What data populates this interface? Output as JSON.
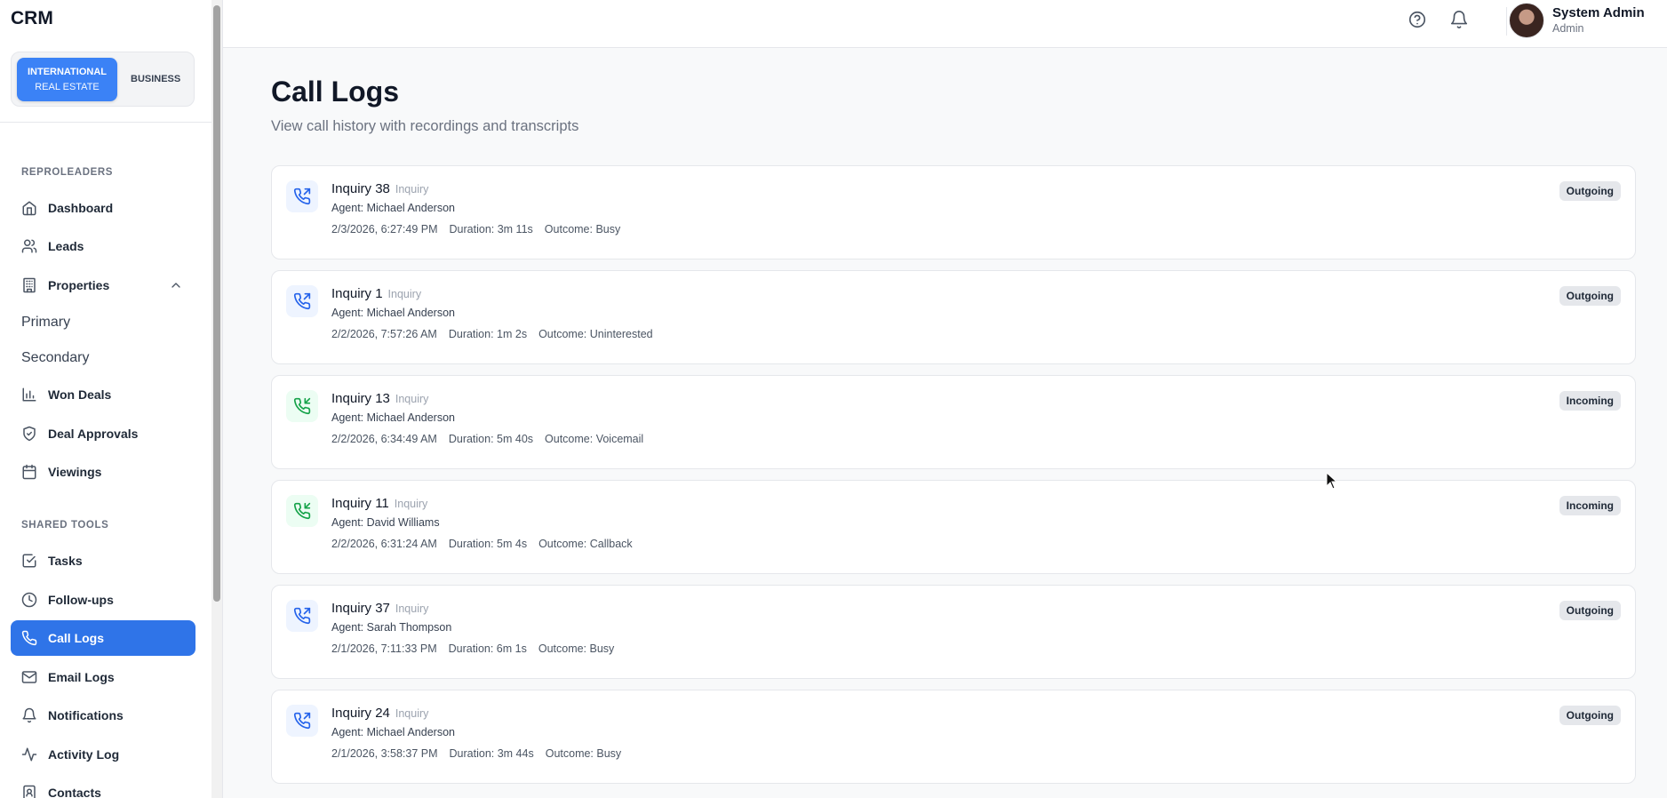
{
  "app": {
    "brand": "CRM"
  },
  "mode_toggle": {
    "active_line1": "INTERNATIONAL",
    "active_line2": "REAL ESTATE",
    "inactive": "BUSINESS"
  },
  "sidebar": {
    "section1": "REPROLEADERS",
    "dashboard": "Dashboard",
    "leads": "Leads",
    "properties": "Properties",
    "primary": "Primary",
    "secondary": "Secondary",
    "won_deals": "Won Deals",
    "deal_approvals": "Deal Approvals",
    "viewings": "Viewings",
    "section2": "SHARED TOOLS",
    "tasks": "Tasks",
    "followups": "Follow-ups",
    "call_logs": "Call Logs",
    "email_logs": "Email Logs",
    "notifications": "Notifications",
    "activity_log": "Activity Log",
    "contacts": "Contacts"
  },
  "header": {
    "user_name": "System Admin",
    "user_role": "Admin"
  },
  "page": {
    "title": "Call Logs",
    "subtitle": "View call history with recordings and transcripts"
  },
  "calls": [
    {
      "title": "Inquiry 38",
      "type": "Inquiry",
      "agent": "Agent: Michael Anderson",
      "datetime": "2/3/2026, 6:27:49 PM",
      "duration": "Duration: 3m 11s",
      "outcome": "Outcome: Busy",
      "direction": "Outgoing"
    },
    {
      "title": "Inquiry 1",
      "type": "Inquiry",
      "agent": "Agent: Michael Anderson",
      "datetime": "2/2/2026, 7:57:26 AM",
      "duration": "Duration: 1m 2s",
      "outcome": "Outcome: Uninterested",
      "direction": "Outgoing"
    },
    {
      "title": "Inquiry 13",
      "type": "Inquiry",
      "agent": "Agent: Michael Anderson",
      "datetime": "2/2/2026, 6:34:49 AM",
      "duration": "Duration: 5m 40s",
      "outcome": "Outcome: Voicemail",
      "direction": "Incoming"
    },
    {
      "title": "Inquiry 11",
      "type": "Inquiry",
      "agent": "Agent: David Williams",
      "datetime": "2/2/2026, 6:31:24 AM",
      "duration": "Duration: 5m 4s",
      "outcome": "Outcome: Callback",
      "direction": "Incoming"
    },
    {
      "title": "Inquiry 37",
      "type": "Inquiry",
      "agent": "Agent: Sarah Thompson",
      "datetime": "2/1/2026, 7:11:33 PM",
      "duration": "Duration: 6m 1s",
      "outcome": "Outcome: Busy",
      "direction": "Outgoing"
    },
    {
      "title": "Inquiry 24",
      "type": "Inquiry",
      "agent": "Agent: Michael Anderson",
      "datetime": "2/1/2026, 3:58:37 PM",
      "duration": "Duration: 3m 44s",
      "outcome": "Outcome: Busy",
      "direction": "Outgoing"
    }
  ],
  "colors": {
    "accent": "#2f74e8",
    "outgoing_icon": "#2563eb",
    "incoming_icon": "#16a34a"
  }
}
